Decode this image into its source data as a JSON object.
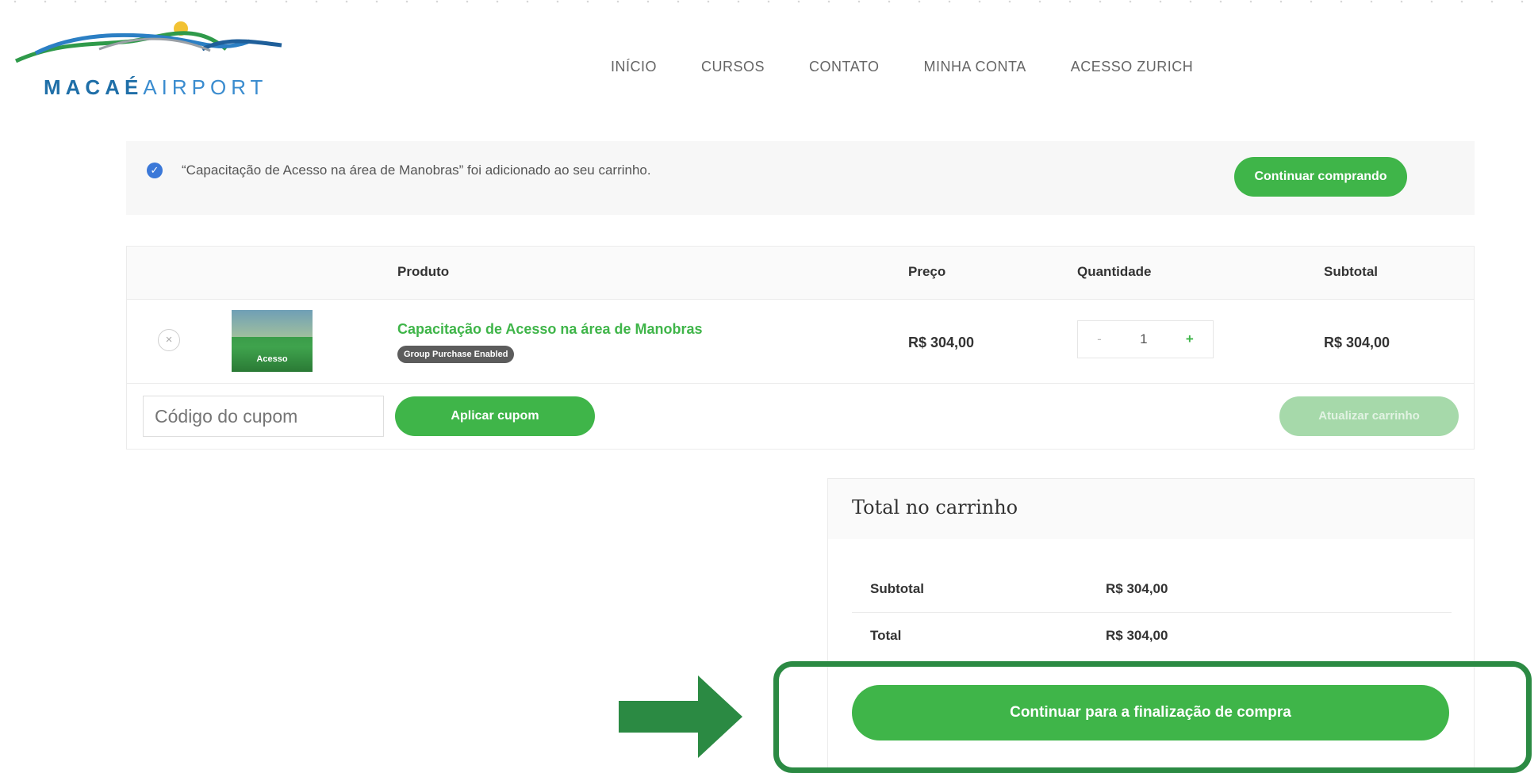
{
  "header": {
    "logo_text_bold": "MACAÉ",
    "logo_text_light": "AIRPORT",
    "nav": [
      "INÍCIO",
      "CURSOS",
      "CONTATO",
      "MINHA CONTA",
      "ACESSO ZURICH"
    ]
  },
  "notice": {
    "message": "“Capacitação de Acesso na área de Manobras” foi adicionado ao seu carrinho.",
    "button": "Continuar comprando"
  },
  "cart": {
    "columns": {
      "product": "Produto",
      "price": "Preço",
      "quantity": "Quantidade",
      "subtotal": "Subtotal"
    },
    "item": {
      "remove": "×",
      "thumb_label": "Acesso",
      "name": "Capacitação de Acesso na área de Manobras",
      "badge": "Group Purchase Enabled",
      "price": "R$ 304,00",
      "qty_minus": "-",
      "qty": "1",
      "qty_plus": "+",
      "subtotal": "R$ 304,00"
    },
    "coupon_placeholder": "Código do cupom",
    "apply_button": "Aplicar cupom",
    "update_button": "Atualizar carrinho"
  },
  "totals": {
    "title": "Total no carrinho",
    "subtotal_label": "Subtotal",
    "subtotal_value": "R$ 304,00",
    "total_label": "Total",
    "total_value": "R$ 304,00",
    "checkout_button": "Continuar para a finalização de compra"
  },
  "colors": {
    "accent_green": "#3fb549",
    "highlight_green": "#2b8a43",
    "notice_check_blue": "#3b78d8"
  }
}
